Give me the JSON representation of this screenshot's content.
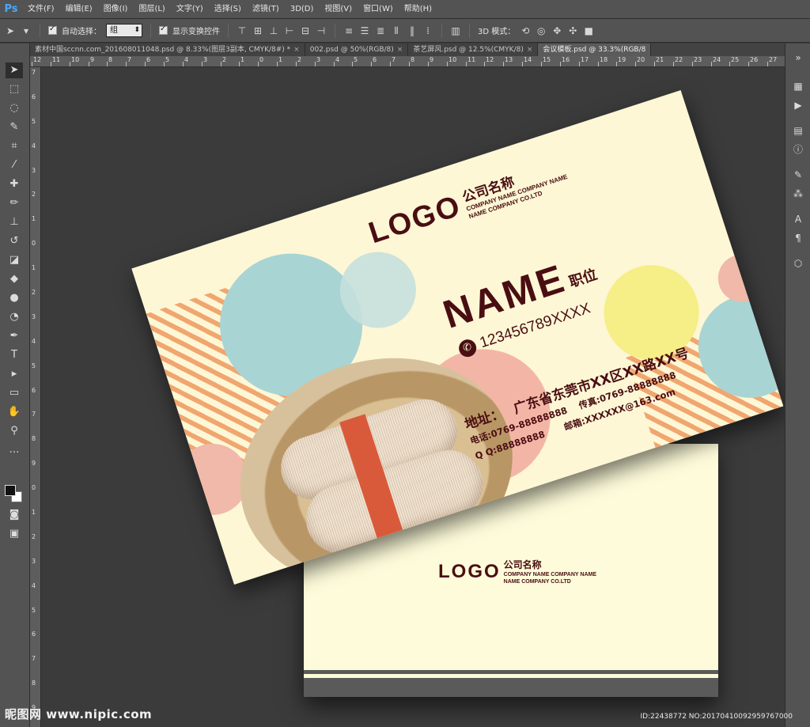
{
  "app": {
    "logo": "Ps"
  },
  "menu": [
    "文件(F)",
    "编辑(E)",
    "图像(I)",
    "图层(L)",
    "文字(Y)",
    "选择(S)",
    "滤镜(T)",
    "3D(D)",
    "视图(V)",
    "窗口(W)",
    "帮助(H)"
  ],
  "options": {
    "auto_select_label": "自动选择：",
    "auto_select_value": "组",
    "show_transform_label": "显示变换控件",
    "mode_3d_label": "3D 模式："
  },
  "tabs": [
    "素材中国sccnn.com_201608011048.psd @ 8.33%(图层3副本, CMYK/8#) *",
    "002.psd @ 50%(RGB/8)",
    "茶艺屏风.psd @ 12.5%(CMYK/8)",
    "会议模板.psd @ 33.3%(RGB/8"
  ],
  "ruler_labels": [
    "12",
    "11",
    "10",
    "9",
    "8",
    "7",
    "6",
    "5",
    "4",
    "3",
    "2",
    "1",
    "0",
    "1",
    "2",
    "3",
    "4",
    "5",
    "6",
    "7",
    "8",
    "9",
    "10",
    "11",
    "12",
    "13",
    "14",
    "15",
    "16",
    "17",
    "18",
    "19",
    "20",
    "21",
    "22",
    "23",
    "24",
    "25",
    "26",
    "27"
  ],
  "ruler_v_labels": [
    "7",
    "6",
    "5",
    "4",
    "3",
    "2",
    "1",
    "0",
    "1",
    "2",
    "3",
    "4",
    "5",
    "6",
    "7",
    "8",
    "9",
    "0",
    "1",
    "2",
    "3",
    "4",
    "5",
    "6",
    "7",
    "8",
    "9"
  ],
  "card_front": {
    "logo": "LOGO",
    "company_cn": "公司名称",
    "company_en_1": "COMPANY NAME COMPANY NAME",
    "company_en_2": "NAME COMPANY CO.LTD",
    "name": "NAME",
    "position": "职位",
    "phone": "123456789XXXX",
    "address_label": "地址：",
    "address": "广东省东莞市XX区XX路XX号",
    "tel": "电话:0769-88888888",
    "fax": "传真:0769-88888888",
    "qq": "Q Q:88888888",
    "email": "邮箱:XXXXXX@163.com"
  },
  "card_back": {
    "logo": "LOGO",
    "company_cn": "公司名称",
    "company_en_1": "COMPANY NAME COMPANY NAME",
    "company_en_2": "NAME COMPANY CO.LTD"
  },
  "watermark": "昵图网 www.nipic.com",
  "image_id": "ID:22438772 NO:20170410092959767000",
  "colors": {
    "ui_panel": "#535353",
    "canvas_bg": "#3b3b3b",
    "card_cream": "#fdf7d6",
    "brand_maroon": "#4a0e12",
    "teal": "#a9d4d4",
    "yellow": "#f6ee86",
    "pink": "#f0b9a9",
    "stripe_orange": "#f1a66f"
  }
}
